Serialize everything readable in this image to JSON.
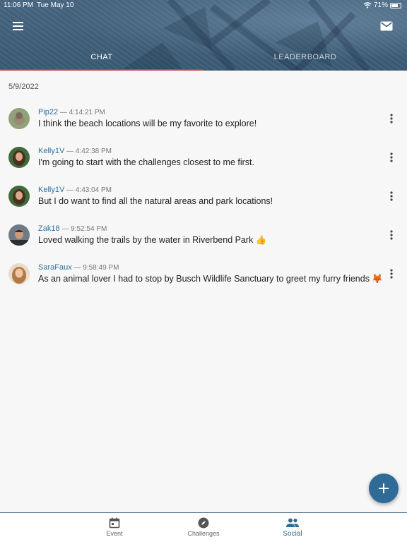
{
  "status_bar": {
    "time": "11:06 PM",
    "date": "Tue May 10",
    "battery": "71%",
    "battery_level": 0.71
  },
  "header": {
    "menu_icon": "hamburger-menu-icon",
    "mail_icon": "mail-icon",
    "tabs": [
      {
        "label": "CHAT",
        "active": true
      },
      {
        "label": "LEADERBOARD",
        "active": false
      }
    ]
  },
  "chat": {
    "date": "5/9/2022",
    "messages": [
      {
        "user": "Pip22",
        "time": "— 4:14:21 PM",
        "text": "I think the beach locations will be my favorite to explore!"
      },
      {
        "user": "Kelly1V",
        "time": "— 4:42:38 PM",
        "text": "I'm going to start with the challenges closest to me first."
      },
      {
        "user": "Kelly1V",
        "time": "— 4:43:04 PM",
        "text": "But I do want to find all the natural areas and park locations!"
      },
      {
        "user": "Zak18",
        "time": "— 9:52:54 PM",
        "text": "Loved walking the trails by the water in Riverbend Park 👍"
      },
      {
        "user": "SaraFaux",
        "time": "— 9:58:49 PM",
        "text": "As an animal lover I had to stop by Busch Wildlife Sanctuary to greet my furry friends 🦊"
      }
    ]
  },
  "fab": {
    "icon": "plus-icon"
  },
  "bottom_nav": [
    {
      "label": "Event",
      "icon": "calendar-icon",
      "active": false
    },
    {
      "label": "Challenges",
      "icon": "compass-icon",
      "active": false
    },
    {
      "label": "Social",
      "icon": "people-icon",
      "active": true
    }
  ],
  "colors": {
    "header": "#3b5a74",
    "accent": "#2e6b96",
    "tab_indicator": "#d33b3b",
    "username": "#2f6f9a"
  }
}
